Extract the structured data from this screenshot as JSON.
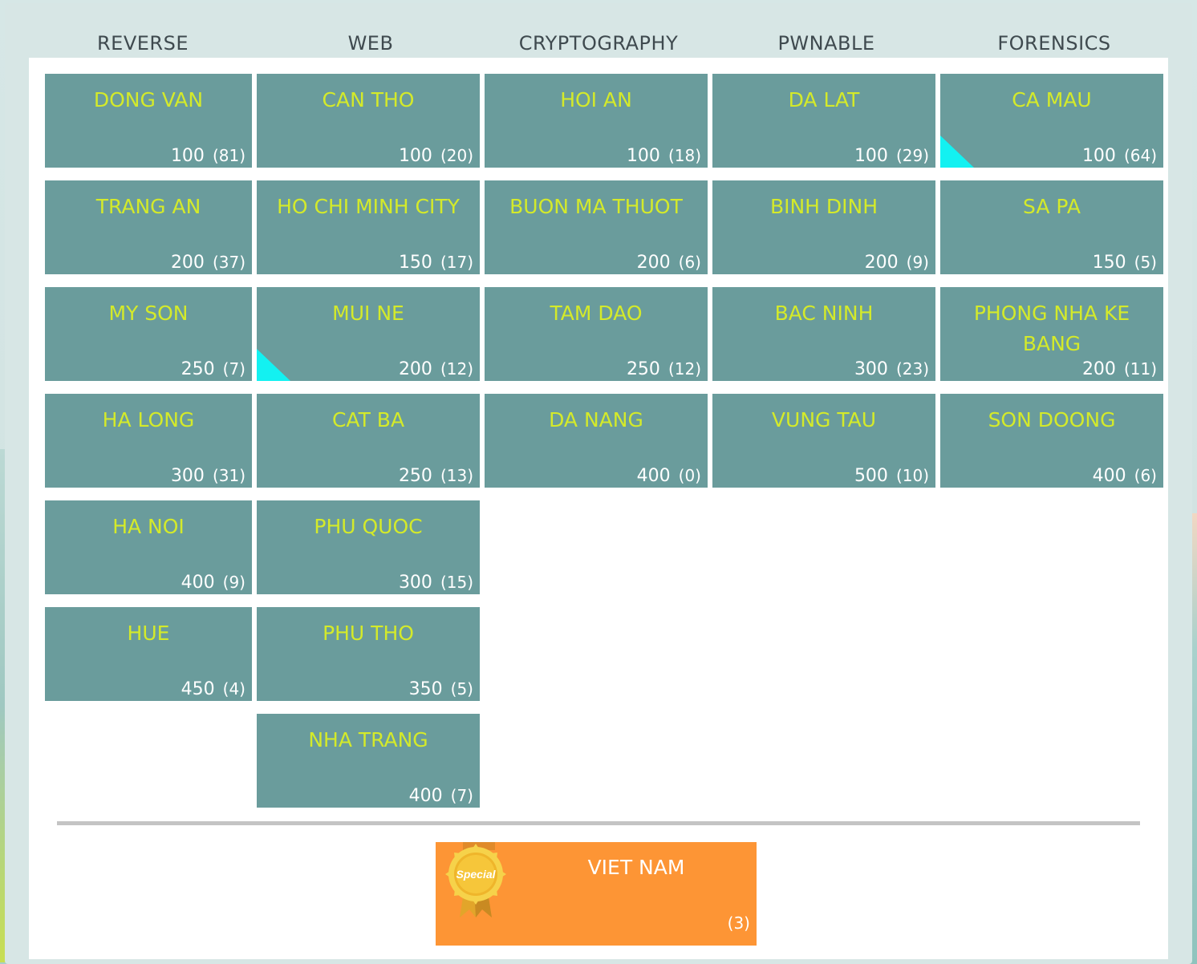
{
  "categories": [
    "REVERSE",
    "WEB",
    "CRYPTOGRAPHY",
    "PWNABLE",
    "FORENSICS"
  ],
  "colors": {
    "tile": "#6a9c9c",
    "tile_title": "#d4ea2a",
    "tile_meta": "#ffffff",
    "solved_marker": "#13f1f1",
    "special_tile": "#fd9535",
    "badge_gold": "#f2c23a"
  },
  "columns": [
    {
      "category": "REVERSE",
      "challenges": [
        {
          "name": "DONG VAN",
          "points": "100",
          "solves": "(81)",
          "solved": false
        },
        {
          "name": "TRANG AN",
          "points": "200",
          "solves": "(37)",
          "solved": false
        },
        {
          "name": "MY SON",
          "points": "250",
          "solves": "(7)",
          "solved": false
        },
        {
          "name": "HA LONG",
          "points": "300",
          "solves": "(31)",
          "solved": false
        },
        {
          "name": "HA NOI",
          "points": "400",
          "solves": "(9)",
          "solved": false
        },
        {
          "name": "HUE",
          "points": "450",
          "solves": "(4)",
          "solved": false
        }
      ]
    },
    {
      "category": "WEB",
      "challenges": [
        {
          "name": "CAN THO",
          "points": "100",
          "solves": "(20)",
          "solved": false
        },
        {
          "name": "HO CHI MINH CITY",
          "points": "150",
          "solves": "(17)",
          "solved": false
        },
        {
          "name": "MUI NE",
          "points": "200",
          "solves": "(12)",
          "solved": true
        },
        {
          "name": "CAT BA",
          "points": "250",
          "solves": "(13)",
          "solved": false
        },
        {
          "name": "PHU QUOC",
          "points": "300",
          "solves": "(15)",
          "solved": false
        },
        {
          "name": "PHU THO",
          "points": "350",
          "solves": "(5)",
          "solved": false
        },
        {
          "name": "NHA TRANG",
          "points": "400",
          "solves": "(7)",
          "solved": false
        }
      ]
    },
    {
      "category": "CRYPTOGRAPHY",
      "challenges": [
        {
          "name": "HOI AN",
          "points": "100",
          "solves": "(18)",
          "solved": false
        },
        {
          "name": "BUON MA THUOT",
          "points": "200",
          "solves": "(6)",
          "solved": false
        },
        {
          "name": "TAM DAO",
          "points": "250",
          "solves": "(12)",
          "solved": false
        },
        {
          "name": "DA NANG",
          "points": "400",
          "solves": "(0)",
          "solved": false
        }
      ]
    },
    {
      "category": "PWNABLE",
      "challenges": [
        {
          "name": "DA LAT",
          "points": "100",
          "solves": "(29)",
          "solved": false
        },
        {
          "name": "BINH DINH",
          "points": "200",
          "solves": "(9)",
          "solved": false
        },
        {
          "name": "BAC NINH",
          "points": "300",
          "solves": "(23)",
          "solved": false
        },
        {
          "name": "VUNG TAU",
          "points": "500",
          "solves": "(10)",
          "solved": false
        }
      ]
    },
    {
      "category": "FORENSICS",
      "challenges": [
        {
          "name": "CA MAU",
          "points": "100",
          "solves": "(64)",
          "solved": true
        },
        {
          "name": "SA PA",
          "points": "150",
          "solves": "(5)",
          "solved": false
        },
        {
          "name": "PHONG NHA KE BANG",
          "points": "200",
          "solves": "(11)",
          "solved": false
        },
        {
          "name": "SON DOONG",
          "points": "400",
          "solves": "(6)",
          "solved": false
        }
      ]
    }
  ],
  "special": {
    "badge_label": "Special",
    "name": "VIET NAM",
    "solves": "(3)"
  }
}
